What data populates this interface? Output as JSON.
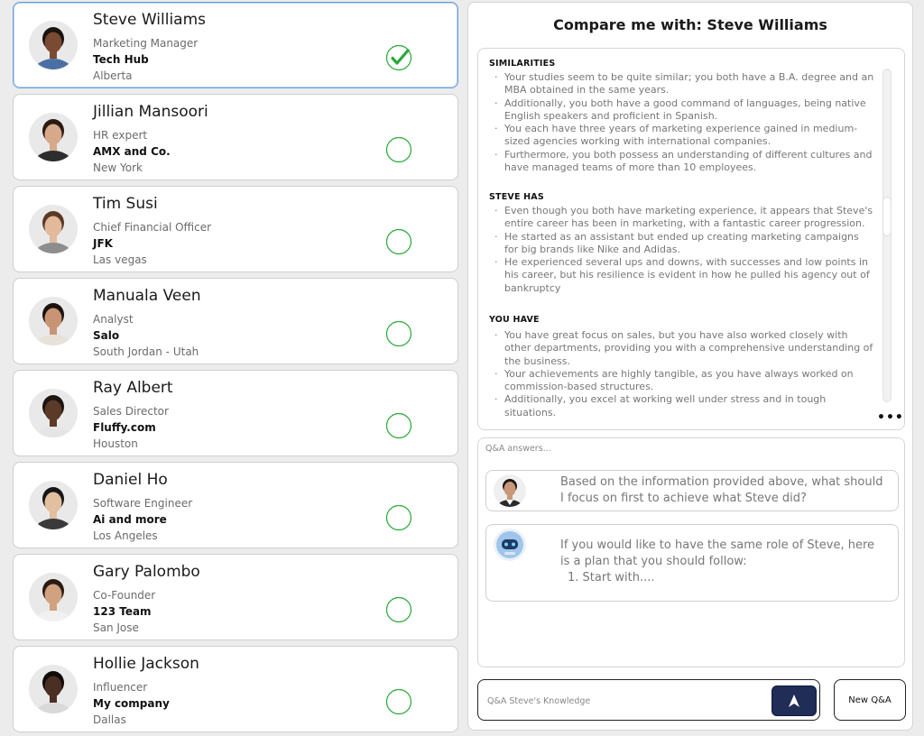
{
  "contacts": [
    {
      "name": "Steve Williams",
      "role": "Marketing Manager",
      "company": "Tech Hub",
      "city": "Alberta",
      "selected": true,
      "skin": "#7a4b32",
      "hair": "#1a1410",
      "shirt": "#4a6fa5"
    },
    {
      "name": "Jillian Mansoori",
      "role": "HR expert",
      "company": "AMX and Co.",
      "city": "New York",
      "selected": false,
      "skin": "#d7a98a",
      "hair": "#2a1a12",
      "shirt": "#2d2d2d"
    },
    {
      "name": "Tim Susi",
      "role": "Chief Financial Officer",
      "company": "JFK",
      "city": "Las vegas",
      "selected": false,
      "skin": "#e3b99b",
      "hair": "#5a3a24",
      "shirt": "#8d8d8d"
    },
    {
      "name": "Manuala Veen",
      "role": "Analyst",
      "company": "Salo",
      "city": "South Jordan - Utah",
      "selected": false,
      "skin": "#c99474",
      "hair": "#1b1210",
      "shirt": "#e7e1d8"
    },
    {
      "name": "Ray Albert",
      "role": "Sales Director",
      "company": "Fluffy.com",
      "city": "Houston",
      "selected": false,
      "skin": "#5b3a28",
      "hair": "#1c1510",
      "shirt": "#e5e5e5"
    },
    {
      "name": "Daniel Ho",
      "role": "Software Engineer",
      "company": "Ai and more",
      "city": "Los Angeles",
      "selected": false,
      "skin": "#e2bf9f",
      "hair": "#161616",
      "shirt": "#3a3a3a"
    },
    {
      "name": "Gary Palombo",
      "role": "Co-Founder",
      "company": "123 Team",
      "city": "San Jose",
      "selected": false,
      "skin": "#d1a27f",
      "hair": "#2a1c14",
      "shirt": "#f1f1f1"
    },
    {
      "name": "Hollie Jackson",
      "role": "Influencer",
      "company": "My company",
      "city": "Dallas",
      "selected": false,
      "skin": "#4b2f22",
      "hair": "#0f0b09",
      "shirt": "#d9d9d9"
    }
  ],
  "compare": {
    "title": "Compare me with: Steve Williams",
    "sections": [
      {
        "heading": "SIMILARITIES",
        "items": [
          "Your studies seem to be quite similar; you both have a B.A. degree and an MBA obtained in the same years.",
          "Additionally, you both have a good command of languages, being native English speakers and proficient in Spanish.",
          "You each have three years of marketing experience gained in medium-sized agencies working with international companies.",
          "Furthermore, you both possess an understanding of different cultures and have managed teams of more than 10 employees."
        ]
      },
      {
        "heading": "STEVE HAS",
        "items": [
          "Even though you both have marketing experience, it appears that Steve's entire career has been in marketing, with a fantastic career progression.",
          "He started as an assistant but ended up creating marketing campaigns for big brands like Nike and Adidas.",
          "He experienced several ups and downs, with successes and low points in his career, but his resilience is evident in how he pulled his agency out of bankruptcy"
        ]
      },
      {
        "heading": "YOU HAVE",
        "items": [
          "You have great focus on sales, but you have also worked closely with other departments, providing you with a comprehensive understanding of the business.",
          "Your achievements are highly tangible, as you have always worked on commission-based structures.",
          "Additionally, you excel at working well under stress and in tough situations."
        ]
      }
    ]
  },
  "qa": {
    "label": "Q&A answers...",
    "question": "Based on the information provided above, what should I focus on first to achieve what Steve did?",
    "answer_intro": "If you would like to have the same role of Steve, here is a plan that you should follow:",
    "answer_step": "1. Start with...."
  },
  "input": {
    "placeholder": "Q&A Steve's Knowledge",
    "value": ""
  },
  "buttons": {
    "send_icon": "upload-arrow-icon",
    "new_qa": "New Q&A"
  },
  "colors": {
    "accent_green": "#29a83a",
    "selected_border": "#6aa0de",
    "send_bg": "#1f2d57"
  }
}
